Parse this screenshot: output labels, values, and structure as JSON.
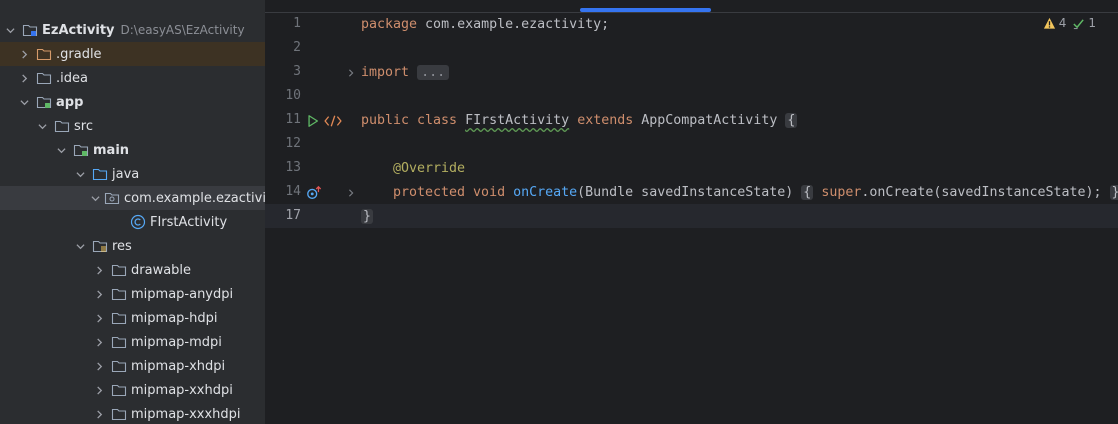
{
  "project_tree": {
    "root": {
      "label": "EzActivity",
      "path": "D:\\easyAS\\EzActivity"
    },
    "items": [
      {
        "label": ".gradle"
      },
      {
        "label": ".idea"
      },
      {
        "label": "app"
      },
      {
        "label": "src"
      },
      {
        "label": "main"
      },
      {
        "label": "java"
      },
      {
        "label": "com.example.ezactivity"
      },
      {
        "label": "FIrstActivity"
      },
      {
        "label": "res"
      },
      {
        "label": "drawable"
      },
      {
        "label": "mipmap-anydpi"
      },
      {
        "label": "mipmap-hdpi"
      },
      {
        "label": "mipmap-mdpi"
      },
      {
        "label": "mipmap-xhdpi"
      },
      {
        "label": "mipmap-xxhdpi"
      },
      {
        "label": "mipmap-xxxhdpi"
      }
    ]
  },
  "editor": {
    "line_numbers": [
      "1",
      "2",
      "3",
      "10",
      "11",
      "12",
      "13",
      "14",
      "17"
    ],
    "code": {
      "l1_kw": "package",
      "l1_rest": " com.example.ezactivity;",
      "l3_kw": "import",
      "l3_fold": "...",
      "l11_kw1": "public class",
      "l11_name": "FIrstActivity",
      "l11_kw2": "extends",
      "l11_super": " AppCompatActivity ",
      "l11_brace": "{",
      "l13_ann": "@Override",
      "l14_kw": "protected void",
      "l14_fn": "onCreate",
      "l14_params": "(Bundle savedInstanceState) ",
      "l14_open": "{",
      "l14_super": "super",
      "l14_call": ".onCreate(savedInstanceState); ",
      "l14_close": "}",
      "l17_brace": "}"
    },
    "inspections": {
      "warnings": "4",
      "weak_warnings": "1"
    }
  },
  "colors": {
    "keyword": "#cf8e6d",
    "function": "#56a8f5",
    "annotation": "#b3ae60",
    "accent": "#3574f0",
    "run": "#5fb865",
    "warning": "#f2c55c"
  }
}
